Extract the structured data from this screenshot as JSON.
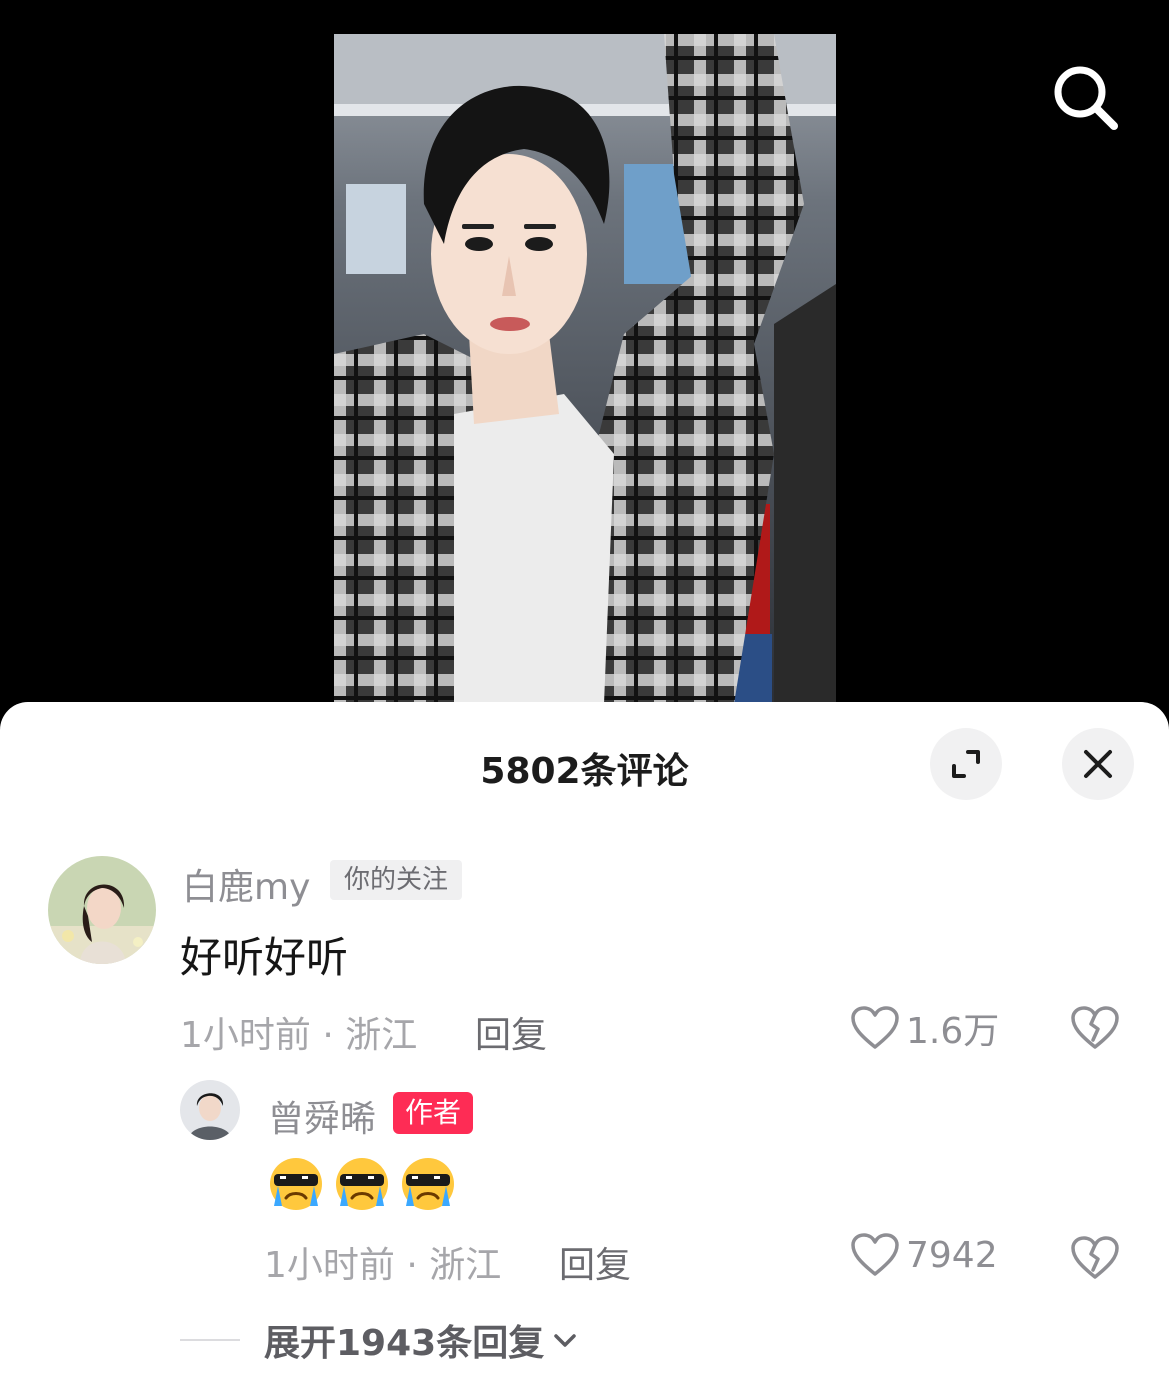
{
  "comments_panel": {
    "title": "5802条评论"
  },
  "comment": {
    "username": "白鹿my",
    "follow_tag": "你的关注",
    "text": "好听好听",
    "meta": "1小时前 · 浙江",
    "reply_label": "回复",
    "like_count": "1.6万"
  },
  "reply": {
    "username": "曾舜晞",
    "author_tag": "作者",
    "emojis": [
      "cool-crying-emoji",
      "cool-crying-emoji",
      "cool-crying-emoji"
    ],
    "meta": "1小时前 · 浙江",
    "reply_label": "回复",
    "like_count": "7942"
  },
  "expand": {
    "label": "展开1943条回复"
  },
  "colors": {
    "accent_red": "#fe2c55",
    "sheet_bg": "#ffffff",
    "muted_text": "#a6a6aa"
  }
}
